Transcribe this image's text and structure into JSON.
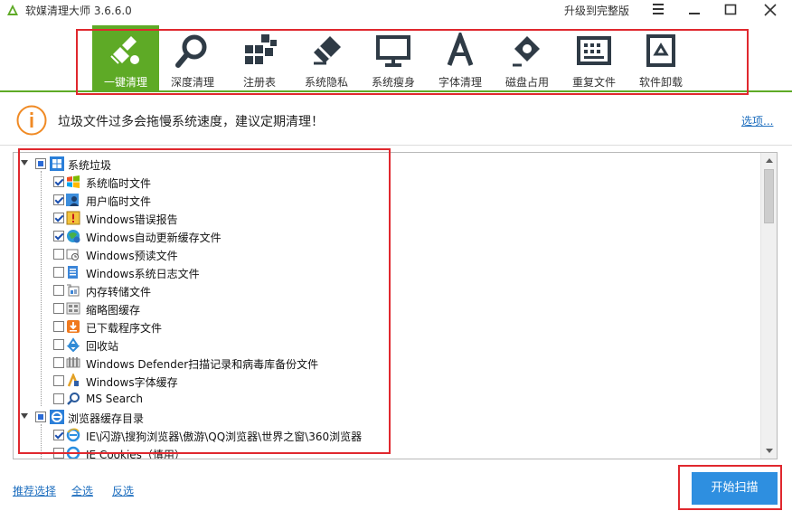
{
  "titlebar": {
    "app_title": "软媒清理大师 3.6.6.0",
    "upgrade_label": "升级到完整版",
    "menu_icon": "hamburger-menu-icon",
    "minimize_icon": "minimize-icon",
    "maximize_icon": "maximize-icon",
    "close_icon": "close-icon"
  },
  "toolbar": {
    "tools": [
      {
        "label": "一键清理",
        "icon": "broom-icon",
        "active": true
      },
      {
        "label": "深度清理",
        "icon": "magnifier-icon",
        "active": false
      },
      {
        "label": "注册表",
        "icon": "registry-blocks-icon",
        "active": false
      },
      {
        "label": "系统隐私",
        "icon": "eraser-icon",
        "active": false
      },
      {
        "label": "系统瘦身",
        "icon": "monitor-icon",
        "active": false
      },
      {
        "label": "字体清理",
        "icon": "font-letter-a-icon",
        "active": false
      },
      {
        "label": "磁盘占用",
        "icon": "disk-pie-icon",
        "active": false
      },
      {
        "label": "重复文件",
        "icon": "duplicate-grid-icon",
        "active": false
      },
      {
        "label": "软件卸载",
        "icon": "recycle-bin-icon",
        "active": false
      }
    ],
    "accent_color": "#5eaa26"
  },
  "infobar": {
    "message": "垃圾文件过多会拖慢系统速度，建议定期清理！",
    "options_label": "选项..."
  },
  "tree": {
    "groups": [
      {
        "label": "系统垃圾",
        "icon": "windows-logo-icon",
        "state": "partial",
        "items": [
          {
            "label": "系统临时文件",
            "icon": "windows-flag-icon",
            "checked": true
          },
          {
            "label": "用户临时文件",
            "icon": "user-icon",
            "checked": true
          },
          {
            "label": "Windows错误报告",
            "icon": "warning-icon",
            "checked": true
          },
          {
            "label": "Windows自动更新缓存文件",
            "icon": "globe-update-icon",
            "checked": true
          },
          {
            "label": "Windows预读文件",
            "icon": "prefetch-icon",
            "checked": false
          },
          {
            "label": "Windows系统日志文件",
            "icon": "log-file-icon",
            "checked": false
          },
          {
            "label": "内存转储文件",
            "icon": "memory-dump-icon",
            "checked": false
          },
          {
            "label": "缩略图缓存",
            "icon": "thumbnail-icon",
            "checked": false
          },
          {
            "label": "已下载程序文件",
            "icon": "download-icon",
            "checked": false
          },
          {
            "label": "回收站",
            "icon": "recycle-icon",
            "checked": false
          },
          {
            "label": "Windows Defender扫描记录和病毒库备份文件",
            "icon": "defender-icon",
            "checked": false
          },
          {
            "label": "Windows字体缓存",
            "icon": "font-cache-icon",
            "checked": false
          },
          {
            "label": "MS Search",
            "icon": "search-icon",
            "checked": false
          }
        ]
      },
      {
        "label": "浏览器缓存目录",
        "icon": "ie-logo-icon",
        "state": "partial",
        "items": [
          {
            "label": "IE\\闪游\\搜狗浏览器\\傲游\\QQ浏览器\\世界之窗\\360浏览器",
            "icon": "ie-icon",
            "checked": true
          },
          {
            "label": "IE Cookies（慎用）",
            "icon": "ie-cookies-icon",
            "checked": false
          }
        ]
      }
    ]
  },
  "bottom": {
    "recommend_label": "推荐选择",
    "select_all_label": "全选",
    "invert_label": "反选",
    "scan_label": "开始扫描"
  }
}
